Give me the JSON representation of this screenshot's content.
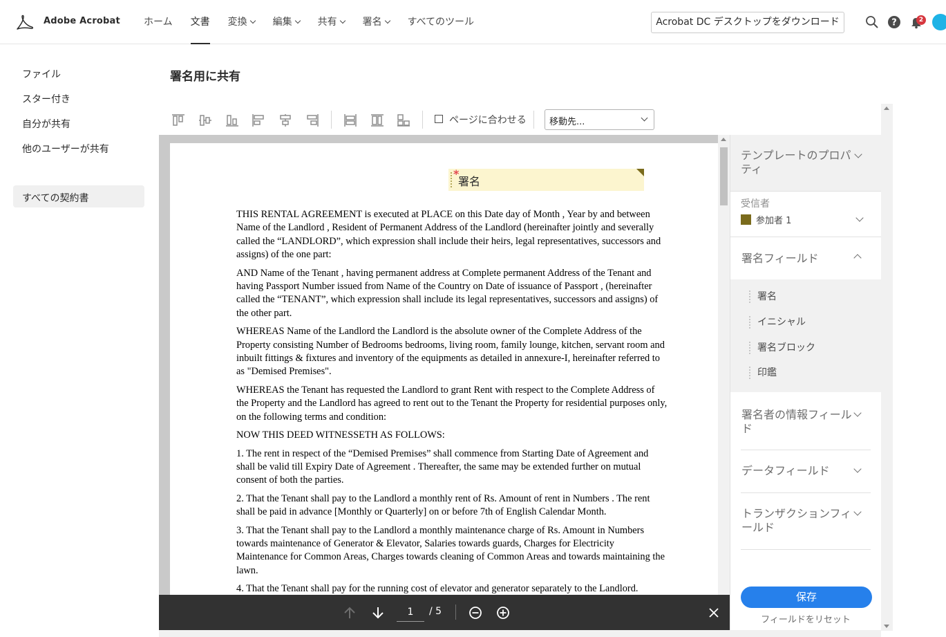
{
  "header": {
    "brand": "Adobe Acrobat",
    "nav": [
      {
        "label": "ホーム",
        "dropdown": false,
        "active": false
      },
      {
        "label": "文書",
        "dropdown": false,
        "active": true
      },
      {
        "label": "変換",
        "dropdown": true,
        "active": false
      },
      {
        "label": "編集",
        "dropdown": true,
        "active": false
      },
      {
        "label": "共有",
        "dropdown": true,
        "active": false
      },
      {
        "label": "署名",
        "dropdown": true,
        "active": false
      },
      {
        "label": "すべてのツール",
        "dropdown": false,
        "active": false
      }
    ],
    "download_label": "Acrobat DC デスクトップをダウンロード",
    "notification_count": "2",
    "icons": [
      "search-icon",
      "help-icon",
      "bell-icon",
      "avatar"
    ]
  },
  "sidebar": {
    "items": [
      "ファイル",
      "スター付き",
      "自分が共有",
      "他のユーザーが共有"
    ],
    "active_item": "すべての契約書"
  },
  "page_title": "署名用に共有",
  "toolbar": {
    "fit_to_page": "ページに合わせる",
    "fit_checked": false,
    "goto_placeholder": "移動先..."
  },
  "document": {
    "signature_field_label": "署名",
    "paragraphs": [
      "THIS RENTAL AGREEMENT is executed at PLACE on this Date day of Month , Year by and between Name of the Landlord , Resident of Permanent Address of the Landlord (hereinafter jointly and severally called the “LANDLORD”, which expression shall include their heirs, legal representatives, successors and assigns) of the one part:",
      "AND Name of the Tenant , having permanent address at Complete permanent Address of the Tenant and having Passport Number issued from Name of the Country on Date of issuance of Passport , (hereinafter called the “TENANT”, which expression shall include its legal representatives, successors and assigns) of the other part.",
      "WHEREAS Name of the Landlord the Landlord is the absolute owner of the Complete Address of the Property consisting Number of Bedrooms bedrooms, living room, family lounge, kitchen, servant room and inbuilt fittings & fixtures and inventory of the equipments as detailed in annexure-I, hereinafter referred to as \"Demised Premises\".",
      "WHEREAS the Tenant has requested the Landlord to grant Rent with respect to the Complete Address of the Property and the Landlord has agreed to rent out to the Tenant the Property for residential purposes only, on the following terms and condition:",
      "NOW THIS DEED WITNESSETH AS FOLLOWS:",
      "1. The rent in respect of the “Demised Premises” shall commence from Starting Date of Agreement and shall be valid till Expiry Date of Agreement . Thereafter, the same may be extended further on mutual consent of both the parties.",
      "2. That the Tenant shall pay to the Landlord a monthly rent of Rs. Amount of rent in Numbers . The rent shall be paid in advance [Monthly or Quarterly] on or before 7th of English Calendar Month.",
      "3. That the Tenant shall pay to the Landlord a monthly maintenance charge of Rs. Amount in Numbers towards maintenance of Generator & Elevator, Salaries towards guards, Charges for Electricity Maintenance for Common Areas, Charges towards cleaning of Common Areas and towards maintaining the lawn.",
      "4. That the Tenant shall pay for the running cost of elevator and generator separately to the Landlord."
    ]
  },
  "pagebar": {
    "current_page": "1",
    "total": "/ 5"
  },
  "panel": {
    "template_properties": "テンプレートのプロパティ",
    "recipients_label": "受信者",
    "recipient_name": "参加者 1",
    "recipient_color": "#7a6b1c",
    "signature_fields_title": "署名フィールド",
    "signature_fields": [
      "署名",
      "イニシャル",
      "署名ブロック",
      "印鑑"
    ],
    "signer_info_title": "署名者の情報フィールド",
    "data_fields_title": "データフィールド",
    "transaction_fields_title": "トランザクションフィールド",
    "save_label": "保存",
    "reset_label": "フィールドをリセット"
  },
  "colors": {
    "accent": "#2680eb",
    "badge": "#d7373f",
    "signature_field_bg": "#fcf5cf",
    "pagebar_bg": "#323232"
  }
}
